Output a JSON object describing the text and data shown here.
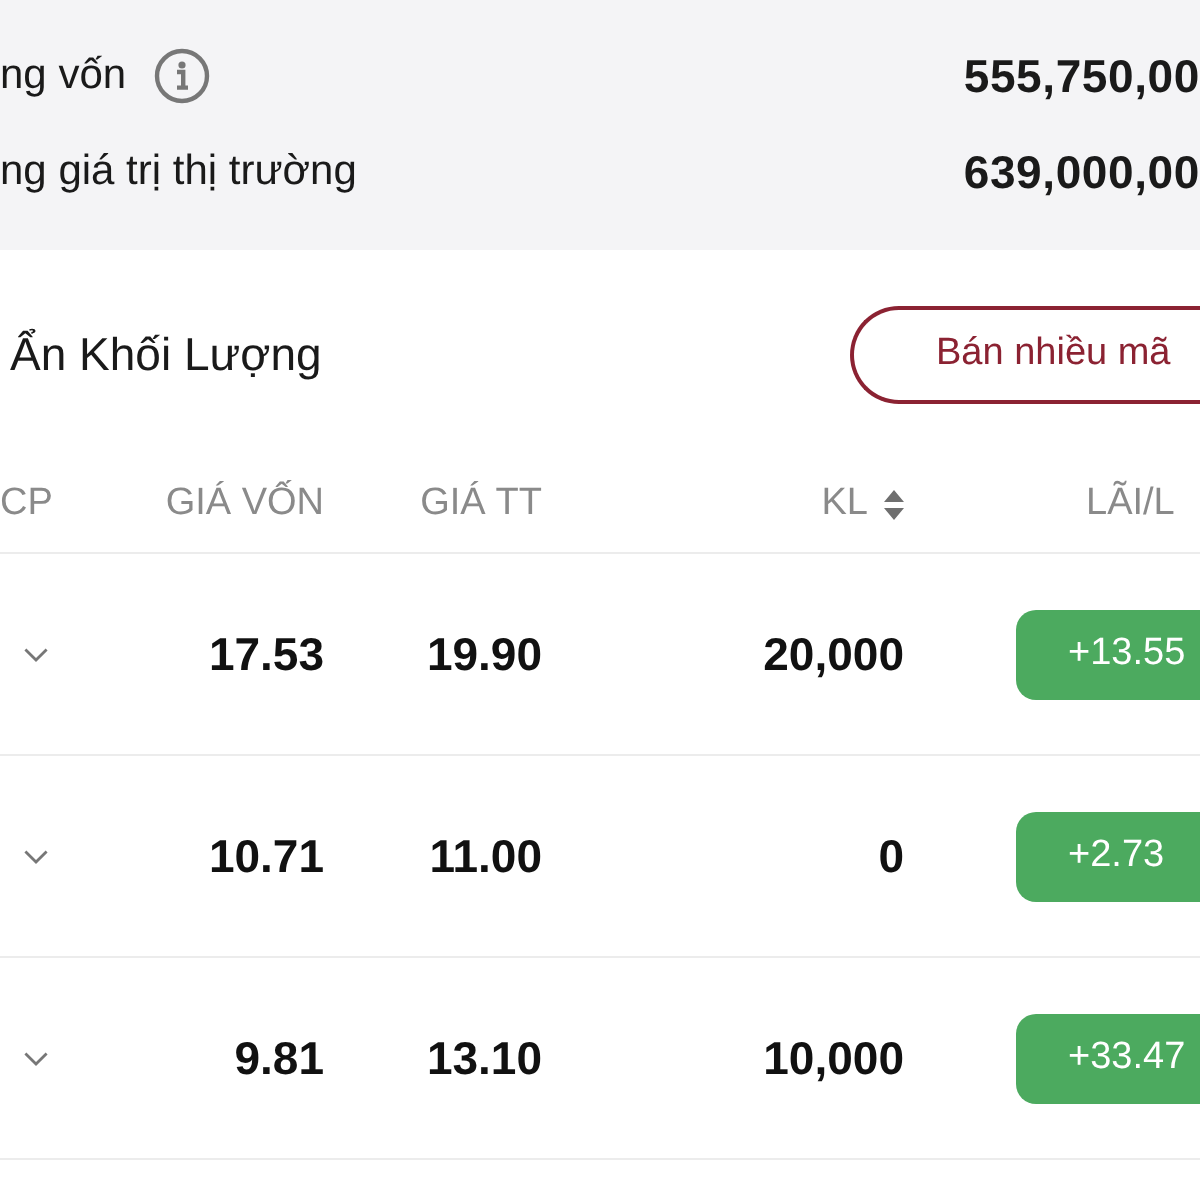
{
  "summary": {
    "rows": [
      {
        "label": "ng vốn",
        "info_icon": true,
        "value": "555,750,00"
      },
      {
        "label": "ng giá trị thị trường",
        "info_icon": false,
        "value": "639,000,00"
      }
    ]
  },
  "toolbar": {
    "toggle_label": "Ẩn Khối Lượng",
    "button": "Bán nhiều mã"
  },
  "table": {
    "columns": [
      {
        "label": "CP",
        "sortable": false
      },
      {
        "label": "GIÁ VỐN",
        "sortable": false
      },
      {
        "label": "GIÁ TT",
        "sortable": false
      },
      {
        "label": "KL",
        "sortable": true
      },
      {
        "label": "LÃI/L",
        "sortable": false
      }
    ],
    "rows": [
      {
        "cost": "17.53",
        "price": "19.90",
        "volume": "20,000",
        "pnl": "+13.55"
      },
      {
        "cost": "10.71",
        "price": "11.00",
        "volume": "0",
        "pnl": "+2.73"
      },
      {
        "cost": "9.81",
        "price": "13.10",
        "volume": "10,000",
        "pnl": "+33.47"
      }
    ]
  }
}
